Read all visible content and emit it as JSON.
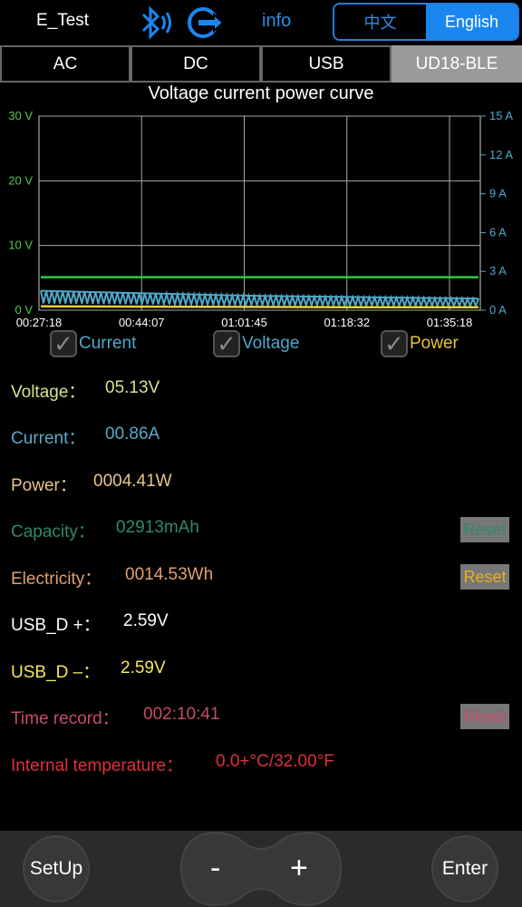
{
  "topbar": {
    "device_name": "E_Test",
    "info_label": "info",
    "lang_zh": "中文",
    "lang_en": "English",
    "accent": "#1a86f0"
  },
  "tabs": [
    {
      "label": "AC",
      "active": false
    },
    {
      "label": "DC",
      "active": false
    },
    {
      "label": "USB",
      "active": false
    },
    {
      "label": "UD18-BLE",
      "active": true
    }
  ],
  "chart_data": {
    "type": "line",
    "title": "Voltage current power curve",
    "x_ticks": [
      "00:27:18",
      "00:44:07",
      "01:01:45",
      "01:18:32",
      "01:35:18"
    ],
    "y_left_ticks": [
      "30 V",
      "20 V",
      "10 V",
      "0 V"
    ],
    "y_left_range": [
      0,
      30
    ],
    "y_right_ticks": [
      "15 A",
      "12 A",
      "9 A",
      "6 A",
      "3 A",
      "0 A"
    ],
    "y_right_range": [
      0,
      15
    ],
    "grid": true,
    "series": [
      {
        "name": "Voltage",
        "axis": "left",
        "color": "#2ecc40",
        "x": [
          "00:27:18",
          "00:44:07",
          "01:01:45",
          "01:18:32",
          "01:35:18"
        ],
        "values": [
          5.1,
          5.1,
          5.1,
          5.1,
          5.1
        ]
      },
      {
        "name": "Current",
        "axis": "right",
        "color": "#4fa8c8",
        "x": [
          "00:27:18",
          "00:44:07",
          "01:01:45",
          "01:18:32",
          "01:35:18"
        ],
        "values": [
          1.5,
          1.3,
          1.1,
          1.0,
          0.9
        ]
      },
      {
        "name": "Power",
        "axis": "left",
        "color": "#e6d23a",
        "x": [
          "00:27:18",
          "00:44:07",
          "01:01:45",
          "01:18:32",
          "01:35:18"
        ],
        "values": [
          0.6,
          0.55,
          0.5,
          0.45,
          0.45
        ]
      }
    ]
  },
  "checkboxes": [
    {
      "label": "Current",
      "color": "#4fa8c8"
    },
    {
      "label": "Voltage",
      "color": "#4fa8c8"
    },
    {
      "label": "Power",
      "color": "#e6c23a"
    }
  ],
  "readings": [
    {
      "label": "Voltage：",
      "value": "05.13V",
      "color": "#d7e08a",
      "reset": ""
    },
    {
      "label": "Current：",
      "value": "00.86A",
      "color": "#5aa8c8",
      "reset": ""
    },
    {
      "label": "Power：",
      "value": "0004.41W",
      "color": "#e8c48a",
      "reset": ""
    },
    {
      "label": "Capacity：",
      "value": "02913mAh",
      "color": "#2f8a6a",
      "reset": "Reset"
    },
    {
      "label": "Electricity：",
      "value": "0014.53Wh",
      "color": "#e0a070",
      "reset": "Reset"
    },
    {
      "label": "USB_D +：",
      "value": "2.59V",
      "color": "#ffffff",
      "reset": ""
    },
    {
      "label": "USB_D –：",
      "value": "2.59V",
      "color": "#f2e85a",
      "reset": ""
    },
    {
      "label": "Time record：",
      "value": "002:10:41",
      "color": "#c84a6a",
      "reset": "Reset"
    },
    {
      "label": "Internal temperature：",
      "value": "0.0+°C/32.00°F",
      "color": "#e0303a",
      "reset": ""
    }
  ],
  "bottom": {
    "setup_label": "SetUp",
    "minus_label": "-",
    "plus_label": "+",
    "enter_label": "Enter"
  }
}
